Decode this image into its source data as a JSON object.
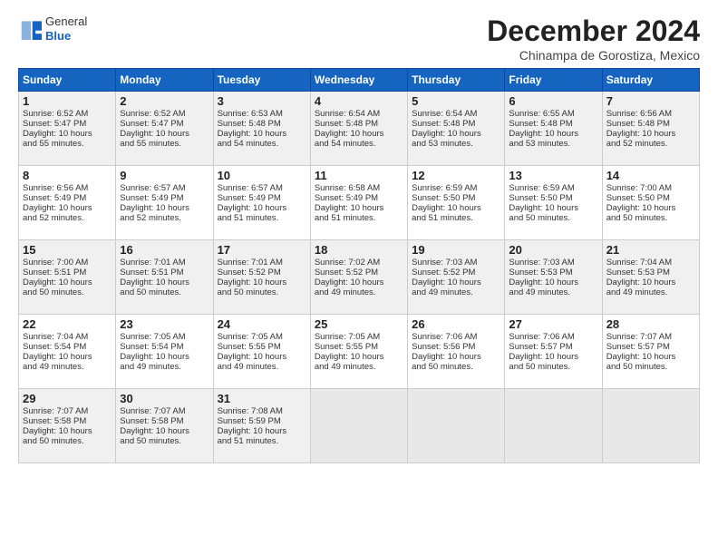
{
  "logo": {
    "general": "General",
    "blue": "Blue"
  },
  "title": "December 2024",
  "location": "Chinampa de Gorostiza, Mexico",
  "weekdays": [
    "Sunday",
    "Monday",
    "Tuesday",
    "Wednesday",
    "Thursday",
    "Friday",
    "Saturday"
  ],
  "weeks": [
    [
      {
        "day": "1",
        "sunrise": "6:52 AM",
        "sunset": "5:47 PM",
        "daylight": "10 hours and 55 minutes."
      },
      {
        "day": "2",
        "sunrise": "6:52 AM",
        "sunset": "5:47 PM",
        "daylight": "10 hours and 55 minutes."
      },
      {
        "day": "3",
        "sunrise": "6:53 AM",
        "sunset": "5:48 PM",
        "daylight": "10 hours and 54 minutes."
      },
      {
        "day": "4",
        "sunrise": "6:54 AM",
        "sunset": "5:48 PM",
        "daylight": "10 hours and 54 minutes."
      },
      {
        "day": "5",
        "sunrise": "6:54 AM",
        "sunset": "5:48 PM",
        "daylight": "10 hours and 53 minutes."
      },
      {
        "day": "6",
        "sunrise": "6:55 AM",
        "sunset": "5:48 PM",
        "daylight": "10 hours and 53 minutes."
      },
      {
        "day": "7",
        "sunrise": "6:56 AM",
        "sunset": "5:48 PM",
        "daylight": "10 hours and 52 minutes."
      }
    ],
    [
      {
        "day": "8",
        "sunrise": "6:56 AM",
        "sunset": "5:49 PM",
        "daylight": "10 hours and 52 minutes."
      },
      {
        "day": "9",
        "sunrise": "6:57 AM",
        "sunset": "5:49 PM",
        "daylight": "10 hours and 52 minutes."
      },
      {
        "day": "10",
        "sunrise": "6:57 AM",
        "sunset": "5:49 PM",
        "daylight": "10 hours and 51 minutes."
      },
      {
        "day": "11",
        "sunrise": "6:58 AM",
        "sunset": "5:49 PM",
        "daylight": "10 hours and 51 minutes."
      },
      {
        "day": "12",
        "sunrise": "6:59 AM",
        "sunset": "5:50 PM",
        "daylight": "10 hours and 51 minutes."
      },
      {
        "day": "13",
        "sunrise": "6:59 AM",
        "sunset": "5:50 PM",
        "daylight": "10 hours and 50 minutes."
      },
      {
        "day": "14",
        "sunrise": "7:00 AM",
        "sunset": "5:50 PM",
        "daylight": "10 hours and 50 minutes."
      }
    ],
    [
      {
        "day": "15",
        "sunrise": "7:00 AM",
        "sunset": "5:51 PM",
        "daylight": "10 hours and 50 minutes."
      },
      {
        "day": "16",
        "sunrise": "7:01 AM",
        "sunset": "5:51 PM",
        "daylight": "10 hours and 50 minutes."
      },
      {
        "day": "17",
        "sunrise": "7:01 AM",
        "sunset": "5:52 PM",
        "daylight": "10 hours and 50 minutes."
      },
      {
        "day": "18",
        "sunrise": "7:02 AM",
        "sunset": "5:52 PM",
        "daylight": "10 hours and 49 minutes."
      },
      {
        "day": "19",
        "sunrise": "7:03 AM",
        "sunset": "5:52 PM",
        "daylight": "10 hours and 49 minutes."
      },
      {
        "day": "20",
        "sunrise": "7:03 AM",
        "sunset": "5:53 PM",
        "daylight": "10 hours and 49 minutes."
      },
      {
        "day": "21",
        "sunrise": "7:04 AM",
        "sunset": "5:53 PM",
        "daylight": "10 hours and 49 minutes."
      }
    ],
    [
      {
        "day": "22",
        "sunrise": "7:04 AM",
        "sunset": "5:54 PM",
        "daylight": "10 hours and 49 minutes."
      },
      {
        "day": "23",
        "sunrise": "7:05 AM",
        "sunset": "5:54 PM",
        "daylight": "10 hours and 49 minutes."
      },
      {
        "day": "24",
        "sunrise": "7:05 AM",
        "sunset": "5:55 PM",
        "daylight": "10 hours and 49 minutes."
      },
      {
        "day": "25",
        "sunrise": "7:05 AM",
        "sunset": "5:55 PM",
        "daylight": "10 hours and 49 minutes."
      },
      {
        "day": "26",
        "sunrise": "7:06 AM",
        "sunset": "5:56 PM",
        "daylight": "10 hours and 50 minutes."
      },
      {
        "day": "27",
        "sunrise": "7:06 AM",
        "sunset": "5:57 PM",
        "daylight": "10 hours and 50 minutes."
      },
      {
        "day": "28",
        "sunrise": "7:07 AM",
        "sunset": "5:57 PM",
        "daylight": "10 hours and 50 minutes."
      }
    ],
    [
      {
        "day": "29",
        "sunrise": "7:07 AM",
        "sunset": "5:58 PM",
        "daylight": "10 hours and 50 minutes."
      },
      {
        "day": "30",
        "sunrise": "7:07 AM",
        "sunset": "5:58 PM",
        "daylight": "10 hours and 50 minutes."
      },
      {
        "day": "31",
        "sunrise": "7:08 AM",
        "sunset": "5:59 PM",
        "daylight": "10 hours and 51 minutes."
      },
      null,
      null,
      null,
      null
    ]
  ],
  "labels": {
    "sunrise": "Sunrise: ",
    "sunset": "Sunset: ",
    "daylight": "Daylight: "
  }
}
